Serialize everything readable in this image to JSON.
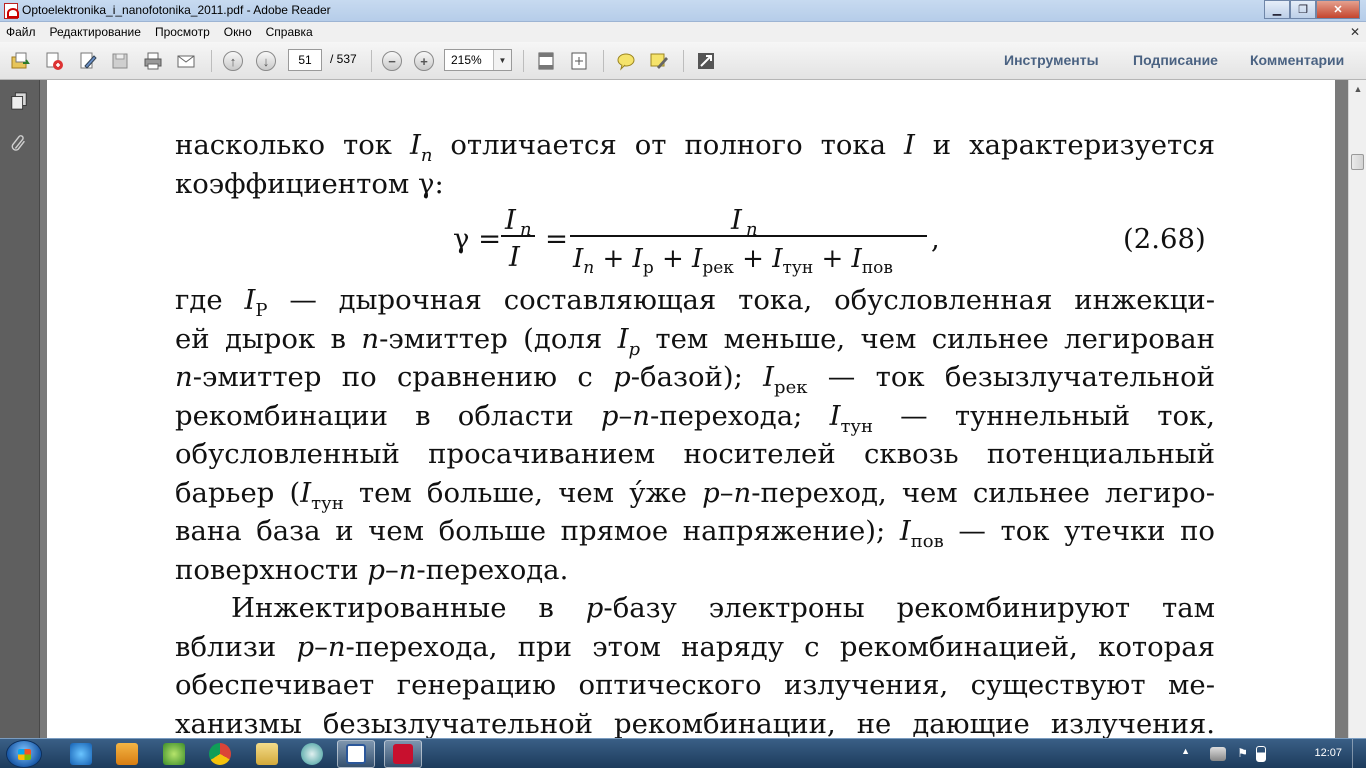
{
  "window": {
    "title": "Optoelektronika_i_nanofotonika_2011.pdf - Adobe Reader",
    "minimize": "▁",
    "maximize": "❐",
    "close": "✕"
  },
  "menu": {
    "items": [
      "Файл",
      "Редактирование",
      "Просмотр",
      "Окно",
      "Справка"
    ],
    "close_glyph": "✕"
  },
  "toolbar": {
    "page_current": "51",
    "page_total": "/ 537",
    "zoom": "215%",
    "tools_label": "Инструменты",
    "sign_label": "Подписание",
    "comment_label": "Комментарии"
  },
  "document": {
    "line1_a": "насколько ток ",
    "line1_b": " отличается от полного тока ",
    "line1_c": " и характеризуется",
    "line2": "коэффициентом γ:",
    "formula": {
      "gamma": "γ =",
      "num1": "I",
      "num1_sub": "n",
      "den1": "I",
      "eq": "=",
      "num2": "I",
      "num2_sub": "n",
      "den2_parts": [
        "I",
        "n",
        "+ I",
        "р",
        "+ I",
        "рек",
        "+ I",
        "тун",
        "+ I",
        "пов"
      ],
      "comma": ",",
      "number": "(2.68)"
    },
    "p1": [
      "где I_Р — дырочная составляющая тока, обусловленная инжекци-",
      "ей дырок в n-эмиттер (доля I_p тем меньше, чем сильнее легирован",
      "n-эмиттер по сравнению с p-базой); I_рек — ток безызлучательной",
      "рекомбинации в области p–n-перехода; I_тун — туннельный ток,",
      "обусловленный просачиванием носителей сквозь потенциальный",
      "барьер (I_тун тем больше, чем у́же p–n-переход, чем сильнее легиро-",
      "вана база и чем больше прямое напряжение); I_пов — ток утечки по",
      "поверхности p–n-перехода."
    ],
    "p2": [
      "Инжектированные в p-базу электроны рекомбинируют там",
      "вблизи p–n-перехода, при этом наряду с рекомбинацией, которая",
      "обеспечивает генерацию оптического излучения, существуют ме-",
      "ханизмы безызлучательной рекомбинации, не дающие излучения."
    ],
    "sym_I": "I",
    "sym_n": "n",
    "sym_p": "p",
    "sub_P": "Р",
    "sub_p": "p",
    "sub_rek": "рек",
    "sub_tun": "тун",
    "sub_pov": "пов"
  },
  "taskbar": {
    "time": "12:07"
  },
  "colors": {
    "accent_text": "#4a6282",
    "background": "#6d6d6d",
    "page": "#ffffff"
  }
}
